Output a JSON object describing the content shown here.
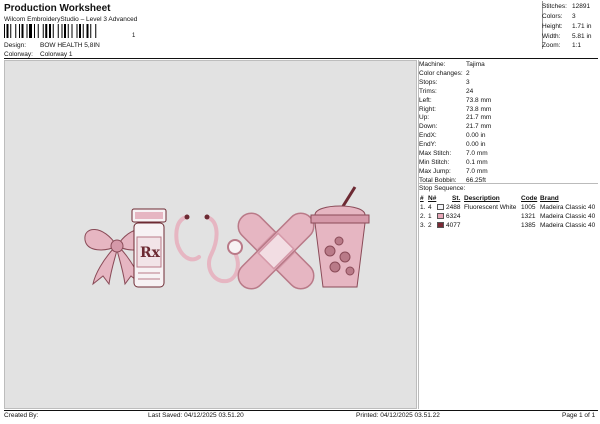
{
  "header": {
    "title": "Production Worksheet",
    "subtitle": "Wilcom EmbroideryStudio – Level 3 Advanced",
    "barcode_text": "1",
    "design_label": "Design:",
    "design_value": "BOW HEALTH 5,8IN",
    "colorway_label": "Colorway:",
    "colorway_value": "Colorway 1"
  },
  "summary": [
    {
      "label": "Stitches:",
      "value": "12891"
    },
    {
      "label": "Colors:",
      "value": "3"
    },
    {
      "label": "Height:",
      "value": "1.71 in"
    },
    {
      "label": "Width:",
      "value": "5.81 in"
    },
    {
      "label": "Zoom:",
      "value": "1:1"
    }
  ],
  "details": [
    {
      "label": "Machine:",
      "value": "Tajima"
    },
    {
      "label": "Color changes:",
      "value": "2"
    },
    {
      "label": "Stops:",
      "value": "3"
    },
    {
      "label": "Trims:",
      "value": "24"
    },
    {
      "label": "Left:",
      "value": "73.8 mm"
    },
    {
      "label": "Right:",
      "value": "73.8 mm"
    },
    {
      "label": "Up:",
      "value": "21.7 mm"
    },
    {
      "label": "Down:",
      "value": "21.7 mm"
    },
    {
      "label": "EndX:",
      "value": "0.00 in"
    },
    {
      "label": "EndY:",
      "value": "0.00 in"
    },
    {
      "label": "Max Stitch:",
      "value": "7.0 mm"
    },
    {
      "label": "Min Stitch:",
      "value": "0.1 mm"
    },
    {
      "label": "Max Jump:",
      "value": "7.0 mm"
    },
    {
      "label": "Total Bobbin:",
      "value": "66.25ft"
    }
  ],
  "stop_sequence": {
    "title": "Stop Sequence:",
    "headers": {
      "hash": "#",
      "n": "N#",
      "st": "St.",
      "description": "Description",
      "code": "Code",
      "brand": "Brand"
    },
    "rows": [
      {
        "num": "1.",
        "n": "4",
        "st": "2488",
        "description": "Fluorescent White",
        "code": "1005",
        "brand": "Madeira Classic 40",
        "color": "#f4f4f8"
      },
      {
        "num": "2.",
        "n": "1",
        "st": "6324",
        "description": "",
        "code": "1321",
        "brand": "Madeira Classic 40",
        "color": "#e8a7b8"
      },
      {
        "num": "3.",
        "n": "2",
        "st": "4077",
        "description": "",
        "code": "1385",
        "brand": "Madeira Classic 40",
        "color": "#7a2a35"
      }
    ]
  },
  "design_icons": [
    "bow-icon",
    "rx-bottle-icon",
    "stethoscope-icon",
    "bandage-cross-icon",
    "cup-icon"
  ],
  "colors": {
    "pink": "#e6b6c2",
    "pink_dark": "#b97a88",
    "maroon": "#6d2a33",
    "white": "#f7f2f4"
  },
  "footer": {
    "created_by": "Created By:",
    "last_saved": "Last Saved: 04/12/2025 03.51.20",
    "printed": "Printed: 04/12/2025 03.51.22",
    "page": "Page 1 of 1"
  }
}
